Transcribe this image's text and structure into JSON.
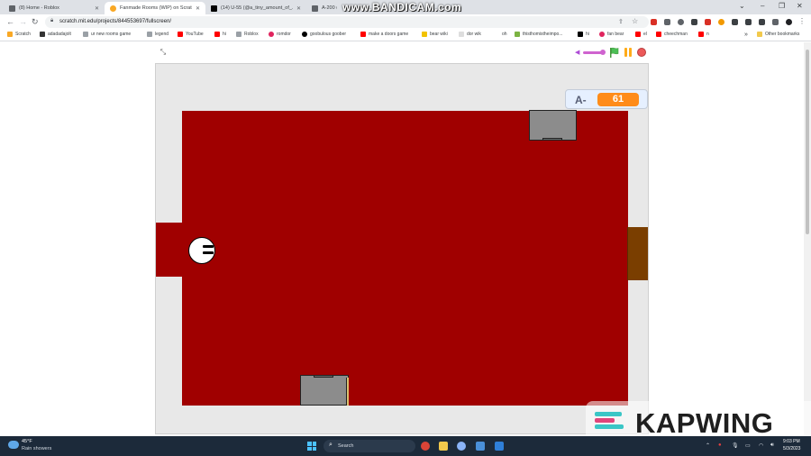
{
  "browser": {
    "tabs": [
      {
        "title": "(8) Home - Roblox",
        "icon_color": "#5f6368"
      },
      {
        "title": "Fanmade Rooms (WIP) on Scratch",
        "icon_color": "#f9a825"
      },
      {
        "title": "(14) U-55 (@a_tiny_amount_of_...",
        "icon_color": "#000000"
      },
      {
        "title": "A-200 (I...",
        "icon_color": "#5f6368"
      }
    ],
    "recorder_watermark": "www.BANDICAM.com",
    "url": "scratch.mit.edu/projects/844553697/fullscreen/",
    "bookmarks": [
      {
        "label": "Scratch",
        "icon_color": "#f9a825"
      },
      {
        "label": "adadadajolt",
        "icon_color": "#333333"
      },
      {
        "label": "ur new rooms game",
        "icon_color": "#9aa0a6"
      },
      {
        "label": "legend",
        "icon_color": "#9aa0a6"
      },
      {
        "label": "YouTube",
        "icon_color": "#ff0000"
      },
      {
        "label": "hi",
        "icon_color": "#ff0000"
      },
      {
        "label": "Roblox",
        "icon_color": "#9aa0a6"
      },
      {
        "label": "romdor",
        "icon_color": "#e0245e"
      },
      {
        "label": "goobulous goober",
        "icon_color": "#000000"
      },
      {
        "label": "make a doors game",
        "icon_color": "#ff0000"
      },
      {
        "label": "bear wiki",
        "icon_color": "#f2c200"
      },
      {
        "label": "dor wik",
        "icon_color": "#dddddd"
      },
      {
        "label": "oh",
        "icon_color": "#ffffff"
      },
      {
        "label": "thisthomistheimpo...",
        "icon_color": "#7cb342"
      },
      {
        "label": "hi",
        "icon_color": "#000000"
      },
      {
        "label": "fan bear",
        "icon_color": "#e0245e"
      },
      {
        "label": "el",
        "icon_color": "#ff0000"
      },
      {
        "label": "cheechman",
        "icon_color": "#ff0000"
      },
      {
        "label": "n",
        "icon_color": "#ff0000"
      }
    ],
    "other_bookmarks": "Other bookmarks"
  },
  "scratch": {
    "variable_monitor": {
      "label": "A-",
      "value": "61"
    }
  },
  "watermark": {
    "text": "KAPWING"
  },
  "taskbar": {
    "weather_temp": "45°F",
    "weather_desc": "Rain showers",
    "search_label": "Search",
    "time": "9:03 PM",
    "date": "5/3/2023"
  }
}
